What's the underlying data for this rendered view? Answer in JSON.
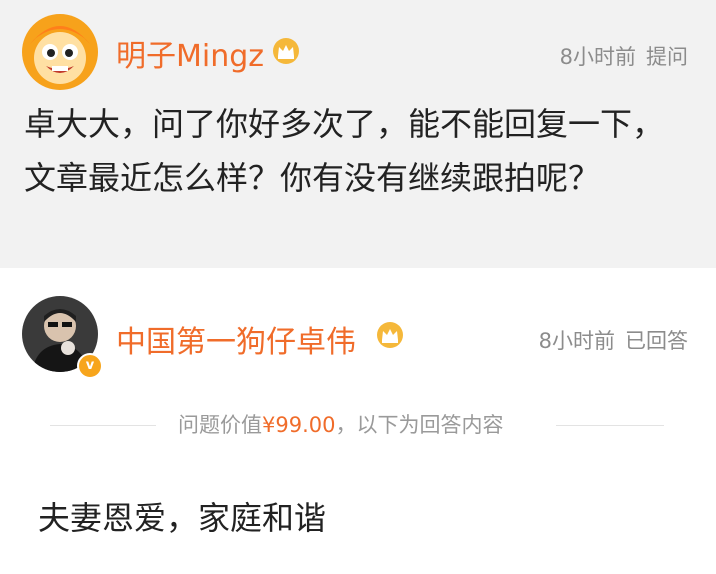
{
  "question": {
    "username": "明子Mingz",
    "time": "8小时前",
    "action": "提问",
    "text": "卓大大，问了你好多次了，能不能回复一下，文章最近怎么样？你有没有继续跟拍呢？"
  },
  "answer": {
    "username": "中国第一狗仔卓伟",
    "time": "8小时前",
    "action": "已回答",
    "verified_badge": "v",
    "divider_prefix": "问题价值",
    "price": "¥99.00",
    "divider_suffix": "，以下为回答内容",
    "text": "夫妻恩爱，家庭和谐"
  },
  "icons": {
    "crown": "crown-icon",
    "verified": "verified-badge-icon"
  },
  "colors": {
    "accent": "#f06c2a",
    "meta": "#8c8c8c",
    "question_bg": "#f2f2f2",
    "crown_gold": "#f5b83a"
  }
}
